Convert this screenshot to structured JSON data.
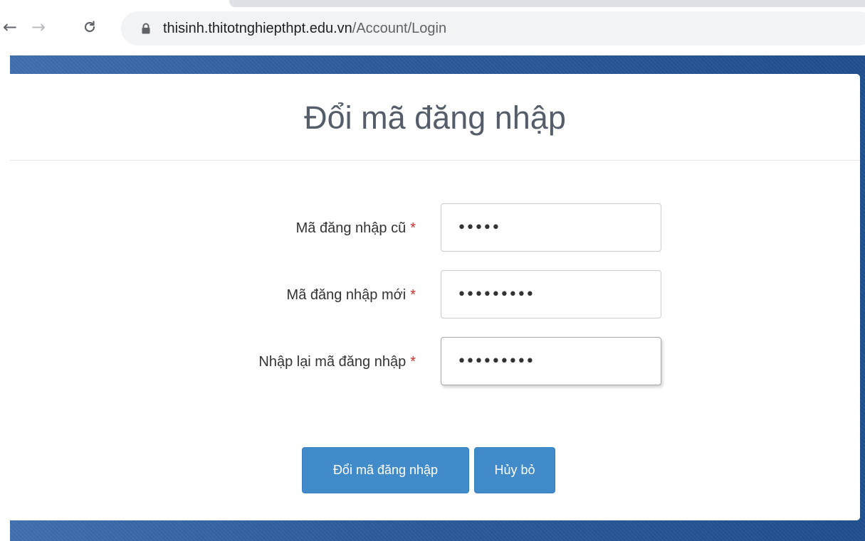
{
  "browser": {
    "nav_back": "←",
    "nav_forward": "→",
    "nav_reload": "C",
    "url_host": "thisinh.thitotnghiepthpt.edu.vn",
    "url_path": "/Account/Login"
  },
  "form": {
    "title": "Đổi mã đăng nhập",
    "fields": [
      {
        "label": "Mã đăng nhập cũ",
        "required_mark": "*",
        "value": "•••••"
      },
      {
        "label": "Mã đăng nhập mới",
        "required_mark": "*",
        "value": "•••••••••"
      },
      {
        "label": "Nhập lại mã đăng nhập",
        "required_mark": "*",
        "value": "•••••••••"
      }
    ],
    "submit_label": "Đổi mã đăng nhập",
    "cancel_label": "Hủy bỏ"
  },
  "colors": {
    "primary_button": "#428bca",
    "required": "#c9302c",
    "page_background": "#2c5c9b"
  }
}
